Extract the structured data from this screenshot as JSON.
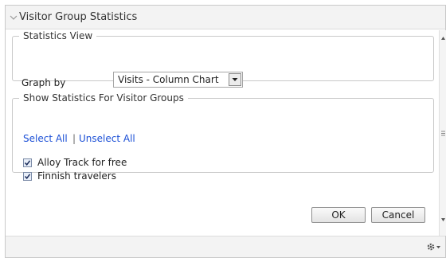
{
  "header": {
    "title": "Visitor Group Statistics",
    "icon": "chevron-down-icon"
  },
  "statistics_view": {
    "legend": "Statistics View",
    "graph_by_label": "Graph by",
    "graph_by_value": "Visits - Column Chart"
  },
  "visitor_groups": {
    "legend": "Show Statistics For Visitor Groups",
    "select_all": "Select All",
    "separator": "|",
    "unselect_all": "Unselect All",
    "items": [
      {
        "label": "Alloy Track for free",
        "checked": true
      },
      {
        "label": "Finnish travelers",
        "checked": true
      }
    ]
  },
  "buttons": {
    "ok": "OK",
    "cancel": "Cancel"
  },
  "footer": {
    "settings_icon": "gear-icon"
  },
  "colors": {
    "link": "#1b4fd6",
    "header_bg": "#f3f3f3",
    "border": "#c9c9c9"
  }
}
